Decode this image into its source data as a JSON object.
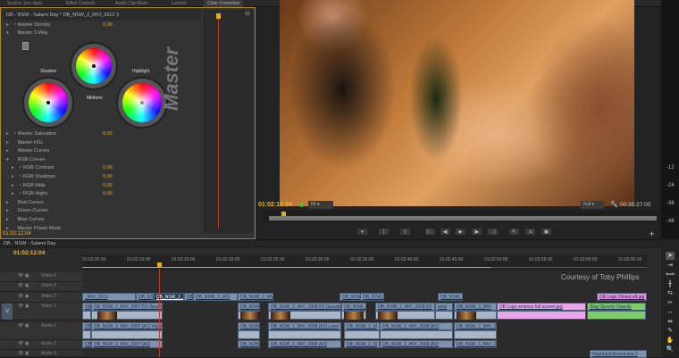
{
  "top_tabs": [
    "Source: (no clips)",
    "Effect Controls",
    "Audio Clip Mixer",
    "Lumetri",
    "Color Correction"
  ],
  "effect_controls": {
    "header": "DB - NSW - Salami Day * DB_NSW_2_MVI_2913 3",
    "mini_label": "01",
    "rows": [
      {
        "label": "Master Density",
        "value": "0.00",
        "fx": true,
        "open": false
      },
      {
        "label": "Master 3-Way",
        "value": "",
        "fx": false,
        "open": true
      }
    ],
    "wheels": {
      "shadow": "Shadow",
      "midtone": "Midtone",
      "highlight": "Highlight",
      "master": "Master"
    },
    "rows2": [
      {
        "label": "Master Saturation",
        "value": "0.00",
        "fx": true,
        "indent": 0
      },
      {
        "label": "Master HSL",
        "value": "",
        "fx": false,
        "indent": 0
      },
      {
        "label": "Master Curves",
        "value": "",
        "fx": false,
        "indent": 0
      },
      {
        "label": "RGB Curves",
        "value": "",
        "fx": false,
        "indent": 0
      },
      {
        "label": "RGB Contrast",
        "value": "0.00",
        "fx": true,
        "indent": 1
      },
      {
        "label": "RGB Shadows",
        "value": "0.00",
        "fx": true,
        "indent": 1
      },
      {
        "label": "RGB Mids",
        "value": "0.00",
        "fx": true,
        "indent": 1
      },
      {
        "label": "RGB Highs",
        "value": "0.00",
        "fx": true,
        "indent": 1
      },
      {
        "label": "Red Curves",
        "value": "",
        "fx": false,
        "indent": 0
      },
      {
        "label": "Green Curves",
        "value": "",
        "fx": false,
        "indent": 0
      },
      {
        "label": "Blue Curves",
        "value": "",
        "fx": false,
        "indent": 0
      },
      {
        "label": "Master Power Mask",
        "value": "",
        "fx": false,
        "indent": 0
      }
    ],
    "timecode": "01:02:12:04"
  },
  "program": {
    "timecode": "01:02:12:04",
    "fit": "Fit",
    "quality": "Full",
    "duration": "00:35:27:00",
    "buttons": [
      "marker",
      "in",
      "out",
      "go-to-in",
      "step-back",
      "play",
      "step-forward",
      "go-to-out",
      "lift",
      "extract",
      "export-frame"
    ],
    "button_glyphs": [
      "▾",
      "{",
      "}",
      "{←",
      "◀|",
      "▶",
      "|▶",
      "→}",
      "⇱",
      "⇲",
      "▣"
    ]
  },
  "meters": [
    "-12",
    "-24",
    "-36",
    "-48"
  ],
  "timeline": {
    "tab": "DB - NSW - Salami Day",
    "timecode": "01:02:12:04",
    "ruler": [
      "01:02:05:00",
      "01:02:10:00",
      "01:02:15:00",
      "01:02:20:00",
      "01:02:25:00",
      "01:02:30:00",
      "01:02:35:00",
      "01:02:40:00",
      "01:02:45:00",
      "01:02:50:00",
      "01:02:55:00",
      "01:03:00:00",
      "01:03:05:00"
    ],
    "tracks": [
      "Video 4",
      "Video 3",
      "Video 2",
      "Video 1",
      "Audio 1",
      "Audio 2",
      "Audio 3"
    ],
    "source_patch": "V",
    "title_overlay": "Courtesy of Toby Phillips",
    "clips": {
      "v2": [
        "_MVI_2913",
        "DB_NSV",
        "DB_NSW_2_V",
        "DB",
        "DB_NSW_2_MVI",
        "DB_NSW_2_MVI_29",
        "DB_NSW_2",
        "DB_NSW_2",
        "DB_NSW_2",
        "DB Logo 2linesLeft.jpg"
      ],
      "v1": [
        "2908 [V]",
        "DB_NSW_2_MVI_2907 [V] Opacity:Opacity",
        "DB_NSW_2_N",
        "DB_NSW_2_MVI_2908 [V] Opacity",
        "DB_NSW_2_MVI",
        "DB_NSW_2_MVI_2908 [V]",
        "acity",
        "DB_NSW_2_MVI",
        "DB Logo emboss full screen.jpg",
        "Slug Opacity:Opacity"
      ],
      "a1": [
        "DB_NSW",
        "DB_NSW_2_MVI_2907 [A1] Volume:Level",
        "DB_NSW_2_N",
        "DB_NSW_2_MVI_2908 [A1] Level",
        "DB_NSW_2_M",
        "DB_NSW_2_MVI_2908 [A1]",
        "DB_NSW_2_MVI_2"
      ],
      "a2": [
        "DB_NSW",
        "DB_NSW_2_MVI_2907 [A2]",
        "DB_NSW_2_N",
        "DB_NSW_2_MVI_2908 [A2]",
        "DB_NSW_2_M",
        "DB_NSW_2_MVI_2908 [A2]",
        "DB_NSW_2_MVI_2"
      ],
      "a3": [
        "Heartland Americana 2"
      ]
    }
  },
  "tools": [
    "selection",
    "track-select",
    "ripple-edit",
    "rolling-edit",
    "rate-stretch",
    "razor",
    "slip",
    "slide",
    "pen",
    "hand",
    "zoom"
  ],
  "tool_glyphs": [
    "➤",
    "⇥",
    "⟺",
    "╫",
    "⇆",
    "✂",
    "↔",
    "⇹",
    "✎",
    "✋",
    "🔍"
  ]
}
